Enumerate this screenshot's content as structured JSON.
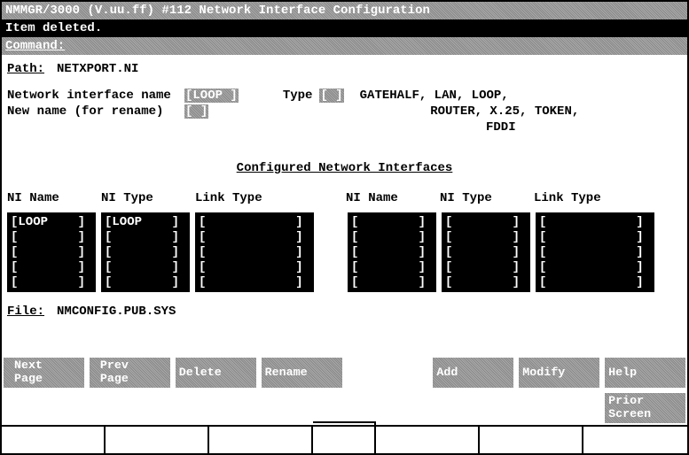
{
  "title": "NMMGR/3000 (V.uu.ff) #112  Network Interface Configuration",
  "message": "Item deleted.",
  "command_label": "Command:",
  "path": {
    "label": "Path:",
    "value": "NETXPORT.NI"
  },
  "fields": {
    "ni_name_label": "Network interface name",
    "ni_name_value": "LOOP    ",
    "new_name_label": "New name (for rename)",
    "new_name_value": "        ",
    "type_label": "Type",
    "type_value": "        ",
    "type_help1": "GATEHALF, LAN, LOOP,",
    "type_help2": "ROUTER, X.25, TOKEN,",
    "type_help3": "FDDI"
  },
  "section_title": "Configured Network Interfaces",
  "headers": {
    "c1": "NI Name",
    "c2": "NI Type",
    "c3": "Link Type",
    "c4": "NI Name",
    "c5": "NI Type",
    "c6": "Link Type"
  },
  "cols": {
    "c1": [
      "LOOP    ",
      "        ",
      "        ",
      "        ",
      "        "
    ],
    "c2": [
      "LOOP    ",
      "        ",
      "        ",
      "        ",
      "        "
    ],
    "c3": [
      "            ",
      "            ",
      "            ",
      "            ",
      "            "
    ],
    "c4": [
      "        ",
      "        ",
      "        ",
      "        ",
      "        "
    ],
    "c5": [
      "        ",
      "        ",
      "        ",
      "        ",
      "        "
    ],
    "c6": [
      "            ",
      "            ",
      "            ",
      "            ",
      "            "
    ]
  },
  "file": {
    "label": "File:",
    "value": "NMCONFIG.PUB.SYS"
  },
  "softkeys": [
    " Next\n Page",
    " Prev\n Page",
    "Delete",
    "Rename",
    "",
    "Add",
    "Modify",
    "Help",
    "Prior\nScreen"
  ]
}
